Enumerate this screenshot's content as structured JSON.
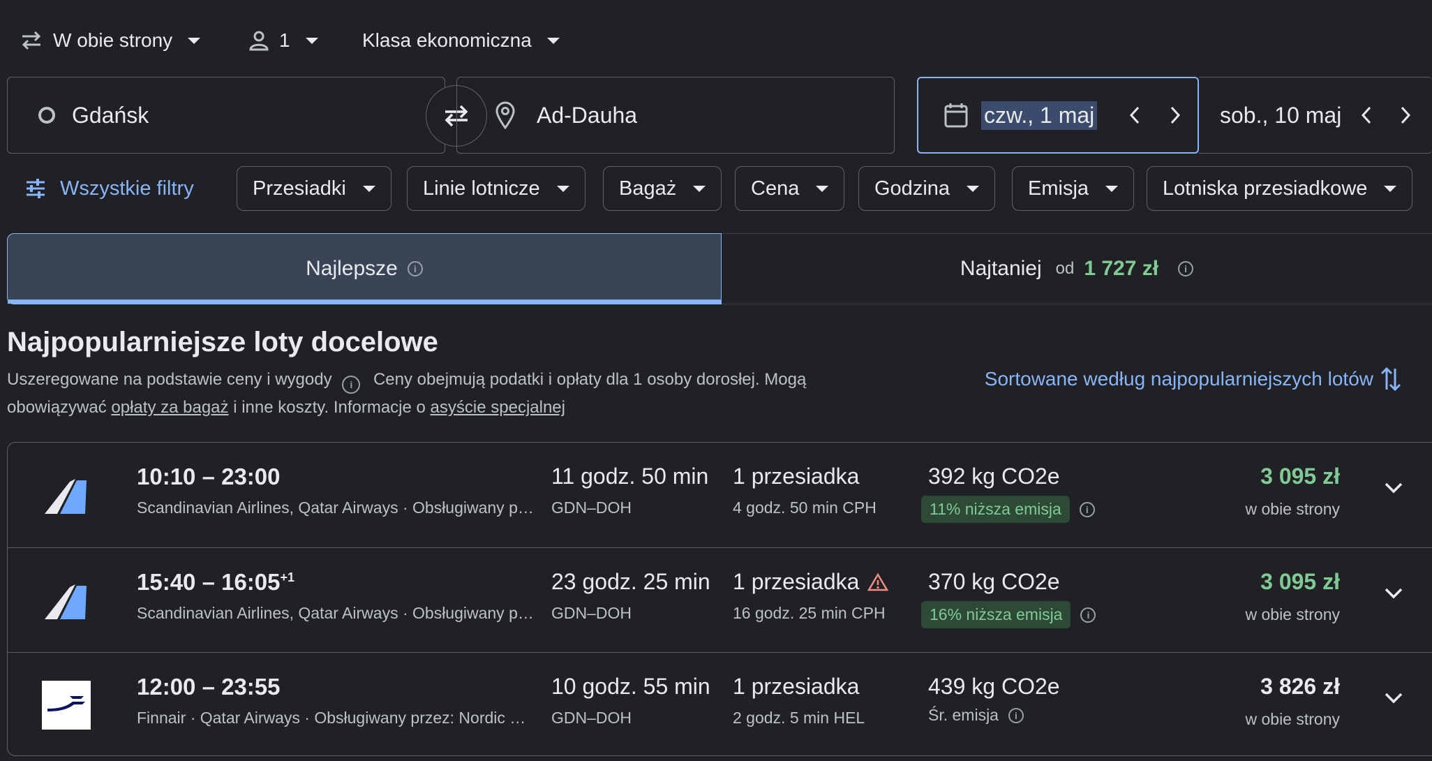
{
  "top_options": {
    "trip_type": "W obie strony",
    "passengers": "1",
    "cabin_class": "Klasa ekonomiczna"
  },
  "search": {
    "origin": "Gdańsk",
    "destination": "Ad-Dauha",
    "depart_date": "czw., 1 maj",
    "return_date": "sob., 10 maj"
  },
  "filters": {
    "all_filters": "Wszystkie filtry",
    "chips": [
      "Przesiadki",
      "Linie lotnicze",
      "Bagaż",
      "Cena",
      "Godzina",
      "Emisja",
      "Lotniska przesiadkowe"
    ]
  },
  "tabs": {
    "best": "Najlepsze",
    "cheapest": "Najtaniej",
    "cheapest_from": "od",
    "cheapest_price": "1 727 zł"
  },
  "section": {
    "title": "Najpopularniejsze loty docelowe",
    "desc_part1": "Uszeregowane na podstawie ceny i wygody",
    "desc_part2": "Ceny obejmują podatki i opłaty dla 1 osoby dorosłej. Mogą obowiązywać",
    "desc_link1": "opłaty za bagaż",
    "desc_part3": "i inne koszty. Informacje o",
    "desc_link2": "asyście specjalnej",
    "sort_label": "Sortowane według najpopularniejszych lotów"
  },
  "flights": [
    {
      "times": "10:10 – 23:00",
      "plus_days": "",
      "airlines": "Scandinavian Airlines, Qatar Airways · Obsługiwany przez: CityJet",
      "duration": "11 godz. 50 min",
      "route": "GDN–DOH",
      "stops": "1 przesiadka",
      "stop_detail": "4 godz. 50 min CPH",
      "co2": "392 kg CO2e",
      "emission": "11% niższa emisja",
      "price": "3 095 zł",
      "price_sub": "w obie strony"
    },
    {
      "times": "15:40 – 16:05",
      "plus_days": "+1",
      "airlines": "Scandinavian Airlines, Qatar Airways · Obsługiwany przez: CityJet",
      "duration": "23 godz. 25 min",
      "route": "GDN–DOH",
      "stops": "1 przesiadka",
      "stop_detail": "16 godz. 25 min CPH",
      "co2": "370 kg CO2e",
      "emission": "16% niższa emisja",
      "price": "3 095 zł",
      "price_sub": "w obie strony"
    },
    {
      "times": "12:00 – 23:55",
      "plus_days": "",
      "airlines": "Finnair · Qatar Airways · Obsługiwany przez: Nordic Regional Airlines",
      "duration": "10 godz. 55 min",
      "route": "GDN–DOH",
      "stops": "1 przesiadka",
      "stop_detail": "2 godz. 5 min HEL",
      "co2": "439 kg CO2e",
      "emission": "Śr. emisja",
      "price": "3 826 zł",
      "price_sub": "w obie strony"
    }
  ],
  "colors": {
    "background": "#202124",
    "accent_blue": "#8ab4f8",
    "price_green": "#81c995",
    "warning_red": "#f28b82"
  }
}
